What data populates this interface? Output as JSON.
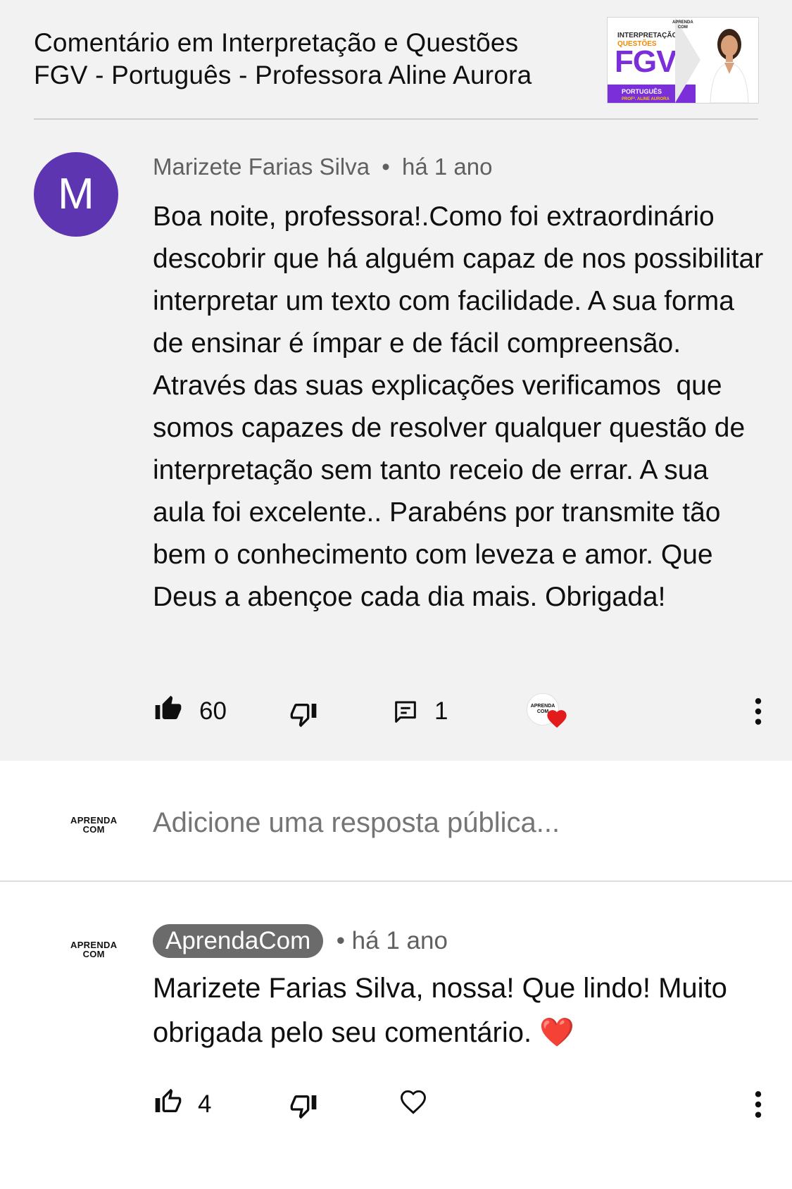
{
  "video": {
    "title_line1": "Comentário em Interpretação e Questões",
    "title_line2": "FGV - Português - Professora Aline Aurora",
    "thumbnail": {
      "line_small": "INTERPRETAÇÃO",
      "line_orange": "QUESTÕES",
      "line_big": "FGV",
      "band_line1": "PORTUGUÊS",
      "band_line2": "PROFª. ALINE AURORA",
      "logo_top": "APRENDA",
      "logo_bottom": "COM"
    }
  },
  "comment": {
    "avatar_letter": "M",
    "avatar_color": "#5e35b1",
    "author": "Marizete Farias Silva",
    "separator": "•",
    "time": "há 1 ano",
    "text": "Boa noite, professora!.Como foi extraordinário descobrir que há alguém capaz de nos possibilitar interpretar um texto com facilidade. A sua forma de ensinar é ímpar e de fácil compreensão. Através das suas explicações verificamos  que somos capazes de resolver qualquer questão de interpretação sem tanto receio de errar. A sua aula foi excelente.. Parabéns por transmite tão bem o conhecimento com leveza e amor. Que Deus a abençoe cada dia mais. Obrigada!",
    "likes": "60",
    "replies": "1",
    "like_icon": "thumb-up-filled-icon",
    "dislike_icon": "thumb-down-outline-icon",
    "reply_icon": "comment-icon",
    "creator_heart_icon": "creator-heart-icon",
    "more_icon": "more-vertical-icon"
  },
  "reply_box": {
    "logo_top": "APRENDA",
    "logo_bottom": "COM",
    "placeholder": "Adicione uma resposta pública..."
  },
  "reply": {
    "logo_top": "APRENDA",
    "logo_bottom": "COM",
    "author": "AprendaCom",
    "time": "• há 1 ano",
    "text": "Marizete Farias Silva, nossa! Que lindo! Muito obrigada pelo seu comentário. ❤️",
    "likes": "4",
    "like_icon": "thumb-up-outline-icon",
    "dislike_icon": "thumb-down-outline-icon",
    "heart_icon": "heart-outline-icon",
    "more_icon": "more-vertical-icon"
  },
  "colors": {
    "top_background": "#f2f2f2",
    "secondary_text": "#606060",
    "author_chip": "#6b6b6b",
    "heart_red": "#e21b1b"
  }
}
